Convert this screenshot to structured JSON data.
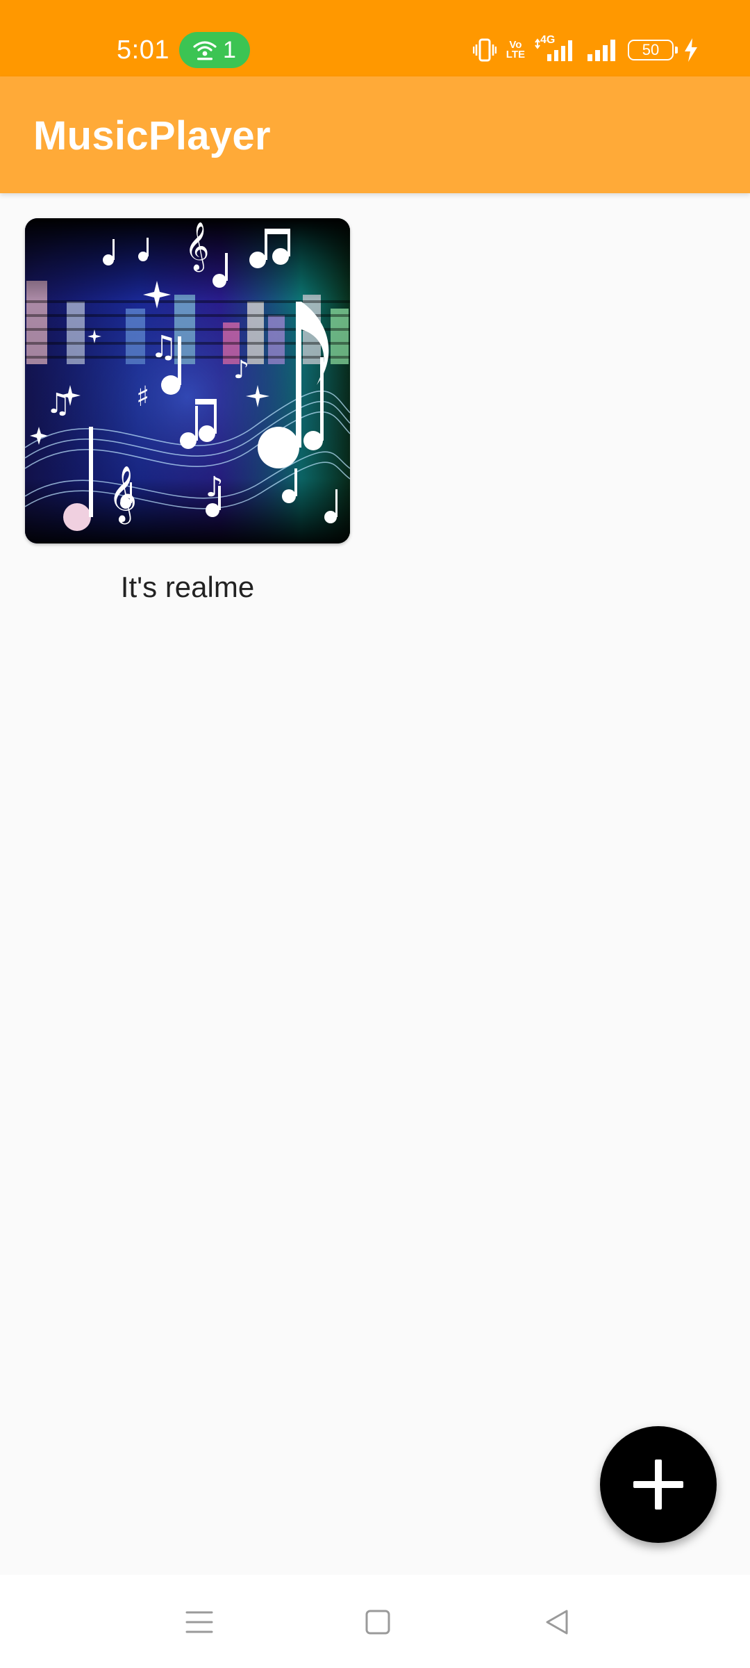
{
  "status_bar": {
    "time": "5:01",
    "hotspot_count": "1",
    "icons": [
      "vibrate-icon",
      "volte-icon",
      "signal-4g-icon",
      "signal-icon",
      "battery-icon",
      "charging-icon"
    ],
    "volte_line1": "Vo",
    "volte_line2": "LTE",
    "network_type": "4G",
    "battery_level": "50",
    "color": "#ff9800",
    "hotspot_color": "#3cc453"
  },
  "app_bar": {
    "title": "MusicPlayer",
    "color": "#ffaa38"
  },
  "albums": [
    {
      "title": "It's realme",
      "art": "music-notes-artwork"
    }
  ],
  "fab": {
    "icon": "plus-icon"
  },
  "nav_bar": {
    "items": [
      {
        "icon": "menu-icon"
      },
      {
        "icon": "home-icon"
      },
      {
        "icon": "back-icon"
      }
    ]
  }
}
